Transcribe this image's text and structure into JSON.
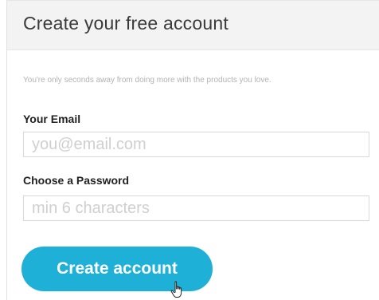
{
  "header": {
    "title": "Create your free account"
  },
  "subtitle": "You're only seconds away from doing more with the products you love.",
  "form": {
    "email": {
      "label": "Your Email",
      "placeholder": "you@email.com",
      "value": ""
    },
    "password": {
      "label": "Choose a Password",
      "placeholder": "min 6 characters",
      "value": ""
    },
    "submit_label": "Create account"
  },
  "colors": {
    "accent": "#1fb0d8",
    "header_bg": "#f3f3f3"
  },
  "icons": {
    "cursor": "hand-pointer-icon"
  }
}
